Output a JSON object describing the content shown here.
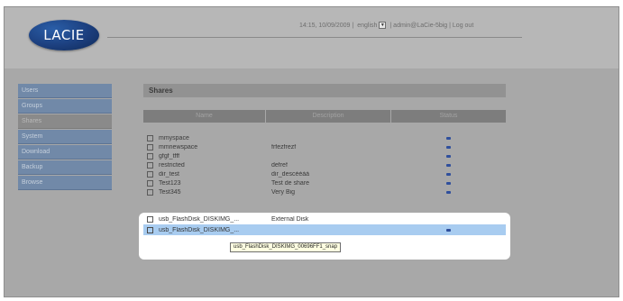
{
  "logo": {
    "text": "LACIE"
  },
  "topbar": {
    "datetime": "14:15, 10/09/2009 |",
    "language": "english",
    "user_links": "| admin@LaCie-5big | Log out"
  },
  "sidebar": {
    "items": [
      {
        "label": "Users"
      },
      {
        "label": "Groups"
      },
      {
        "label": "Shares"
      },
      {
        "label": "System"
      },
      {
        "label": "Download"
      },
      {
        "label": "Backup"
      },
      {
        "label": "Browse"
      }
    ]
  },
  "shares": {
    "title": "Shares",
    "columns": {
      "name": "Name",
      "description": "Description",
      "status": "Status"
    },
    "rows": [
      {
        "name": "mmyspace",
        "description": ""
      },
      {
        "name": "mmnewspace",
        "description": "frfezfrezf"
      },
      {
        "name": "gfgf_tfff",
        "description": ""
      },
      {
        "name": "restricted",
        "description": "defref"
      },
      {
        "name": "dir_test",
        "description": "dir_descééàà"
      },
      {
        "name": "Test123",
        "description": "Test de share"
      },
      {
        "name": "Test345",
        "description": "Very Big"
      },
      {
        "name": "usb_FlashDisk_DISKIMG_...",
        "description": "External Disk"
      },
      {
        "name": "usb_FlashDisk_DISKIMG_...",
        "description": ""
      }
    ],
    "tooltip": "usb_FlashDisk_DISKIMG_00696FF1_snap"
  },
  "colors": {
    "nav_background": "#7189a8",
    "selected_row": "#a8ccf0",
    "status_dot": "#2f4f9c"
  }
}
